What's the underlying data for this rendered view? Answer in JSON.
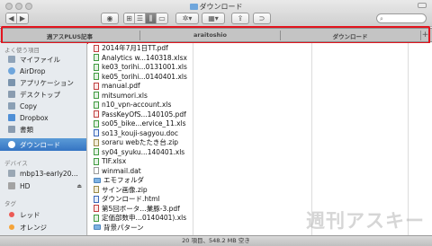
{
  "window": {
    "title": "ダウンロード"
  },
  "tabs": [
    {
      "label": "週アスPLUS記事"
    },
    {
      "label": "araitoshio"
    },
    {
      "label": "ダウンロード"
    }
  ],
  "sidebar": {
    "favorites_heading": "よく使う項目",
    "favorites": [
      {
        "label": "マイファイル",
        "icon": "all-my-files-icon"
      },
      {
        "label": "AirDrop",
        "icon": "airdrop-icon"
      },
      {
        "label": "アプリケーション",
        "icon": "applications-icon"
      },
      {
        "label": "デスクトップ",
        "icon": "desktop-icon"
      },
      {
        "label": "Copy",
        "icon": "copy-folder-icon"
      },
      {
        "label": "Dropbox",
        "icon": "dropbox-icon"
      },
      {
        "label": "書類",
        "icon": "documents-icon"
      },
      {
        "label": "ダウンロード",
        "icon": "downloads-icon",
        "selected": true
      }
    ],
    "devices_heading": "デバイス",
    "devices": [
      {
        "label": "mbp13-early20...",
        "icon": "laptop-icon"
      },
      {
        "label": "HD",
        "icon": "hard-drive-icon"
      }
    ],
    "tags_heading": "タグ",
    "tags": [
      {
        "label": "レッド",
        "color": "#ec5a55"
      },
      {
        "label": "オレンジ",
        "color": "#f5a338"
      }
    ]
  },
  "files": [
    {
      "name": "2014年7月1日TT.pdf",
      "type": "pdf"
    },
    {
      "name": "Analytics w...140318.xlsx",
      "type": "xls"
    },
    {
      "name": "ke03_torihi...0131001.xls",
      "type": "xls"
    },
    {
      "name": "ke05_torihi...0140401.xls",
      "type": "xls"
    },
    {
      "name": "manual.pdf",
      "type": "pdf"
    },
    {
      "name": "mitsumori.xls",
      "type": "xls"
    },
    {
      "name": "n10_vpn-account.xls",
      "type": "xls"
    },
    {
      "name": "PassKeyOfS...140105.pdf",
      "type": "pdf"
    },
    {
      "name": "so05_bike...ervice_11.xls",
      "type": "xls"
    },
    {
      "name": "so13_kouji-sagyou.doc",
      "type": "doc"
    },
    {
      "name": "soraru webたたき台.zip",
      "type": "zip"
    },
    {
      "name": "sy04_syuku...140401.xls",
      "type": "xls"
    },
    {
      "name": "TIF.xlsx",
      "type": "xls"
    },
    {
      "name": "winmail.dat",
      "type": "dat"
    },
    {
      "name": "エモフォルダ",
      "type": "fold"
    },
    {
      "name": "サイン画像.zip",
      "type": "zip"
    },
    {
      "name": "ダウンロード.html",
      "type": "doc"
    },
    {
      "name": "第5回ボータ…業豚-3.pdf",
      "type": "pdf"
    },
    {
      "name": "定価部数申…0140401).xls",
      "type": "xls"
    },
    {
      "name": "背景パターン",
      "type": "fold"
    }
  ],
  "status": {
    "text": "20 項目、548.2 MB 空き"
  },
  "watermark": {
    "text": "週刊アスキー"
  }
}
